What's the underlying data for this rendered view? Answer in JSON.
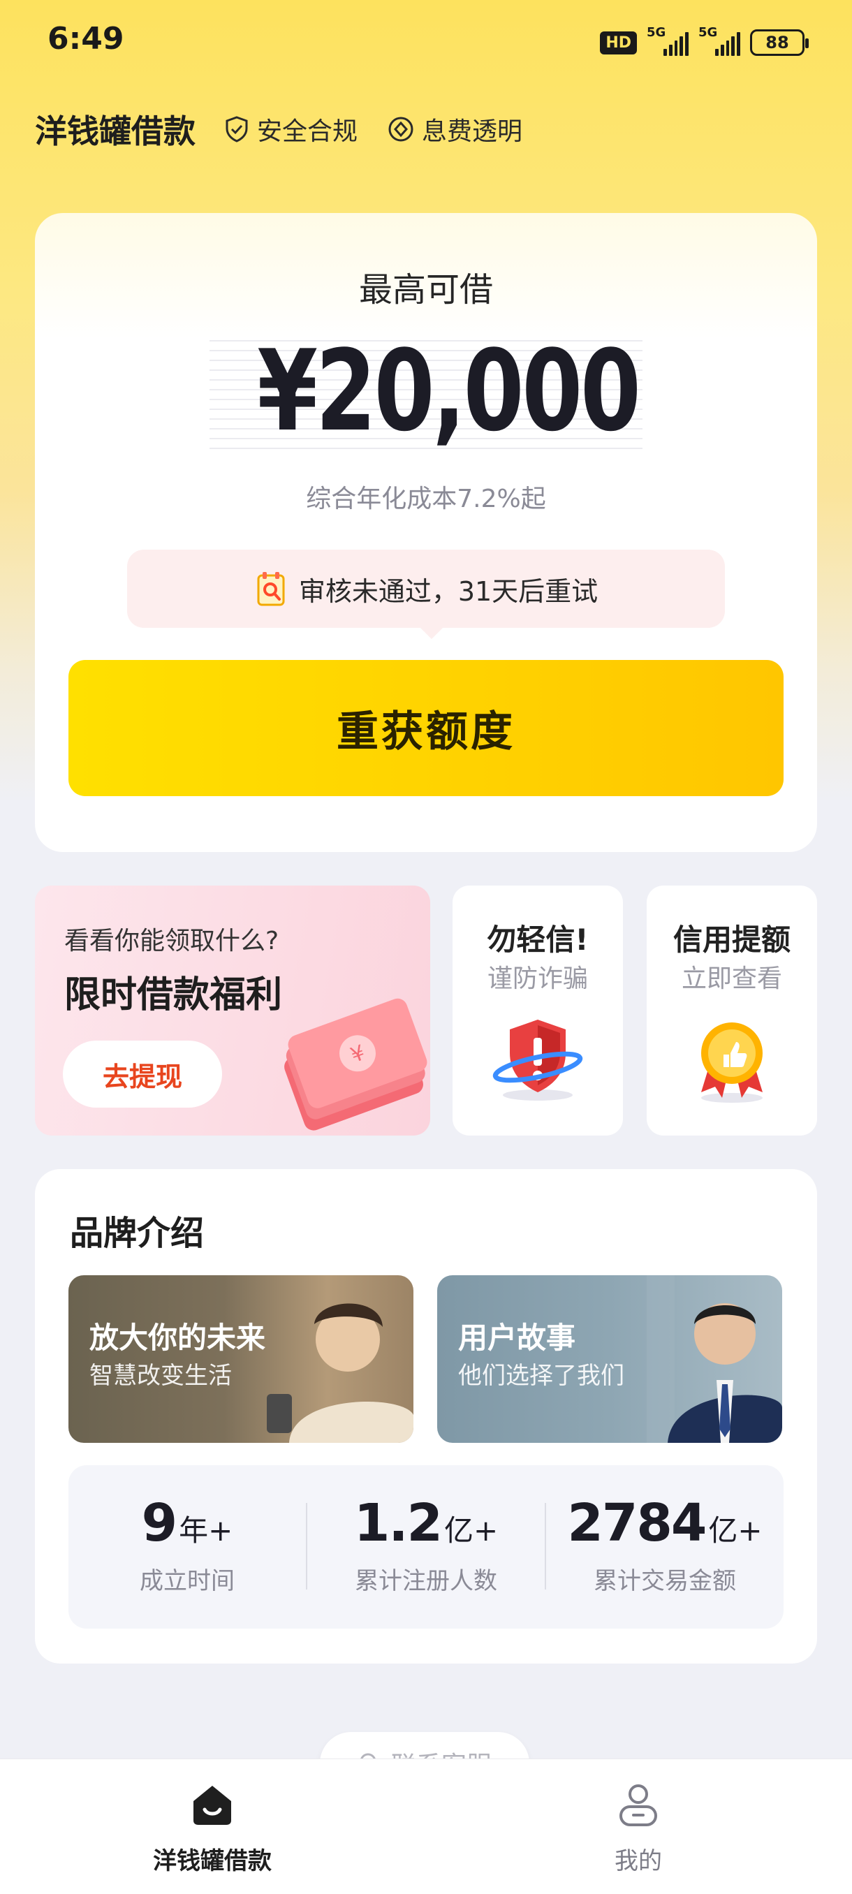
{
  "status_bar": {
    "time": "6:49",
    "hd": "HD",
    "net1": "5G",
    "net2": "5G",
    "battery": "88"
  },
  "header": {
    "brand": "洋钱罐借款",
    "tag1": "安全合规",
    "tag2": "息费透明"
  },
  "loan_card": {
    "title": "最高可借",
    "amount": "¥20,000",
    "rate_text": "综合年化成本7.2%起",
    "notice": "审核未通过，31天后重试",
    "cta_label": "重获额度"
  },
  "promo": {
    "subtitle": "看看你能领取什么?",
    "title": "限时借款福利",
    "button": "去提现"
  },
  "mini_cards": [
    {
      "title": "勿轻信!",
      "subtitle": "谨防诈骗"
    },
    {
      "title": "信用提额",
      "subtitle": "立即查看"
    }
  ],
  "brand_section": {
    "title": "品牌介绍",
    "videos": [
      {
        "title": "放大你的未来",
        "subtitle": "智慧改变生活"
      },
      {
        "title": "用户故事",
        "subtitle": "他们选择了我们"
      }
    ],
    "stats": [
      {
        "value": "9",
        "unit": "年+",
        "label": "成立时间"
      },
      {
        "value": "1.2",
        "unit": "亿+",
        "label": "累计注册人数"
      },
      {
        "value": "2784",
        "unit": "亿+",
        "label": "累计交易金额"
      }
    ]
  },
  "more_chip": "联系客服",
  "tabbar": {
    "home": "洋钱罐借款",
    "mine": "我的"
  },
  "colors": {
    "accent_yellow": "#ffd100",
    "notice_bg": "#fdeeee",
    "promo_button_text": "#e8451e"
  },
  "icons": [
    "shield-check-icon",
    "coin-icon",
    "audit-icon",
    "shield-warning-icon",
    "medal-icon",
    "search-icon",
    "home-icon",
    "user-icon"
  ]
}
